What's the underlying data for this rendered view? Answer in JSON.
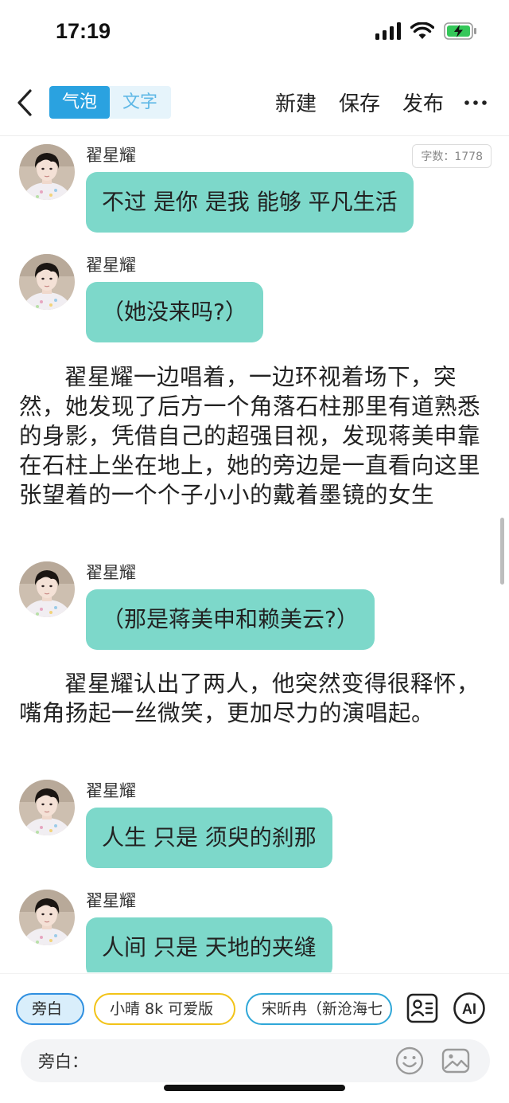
{
  "status": {
    "time": "17:19",
    "battery_color": "#34c759"
  },
  "nav": {
    "tabs": [
      {
        "label": "气泡",
        "active": true
      },
      {
        "label": "文字",
        "active": false
      }
    ],
    "new_label": "新建",
    "save_label": "保存",
    "publish_label": "发布",
    "accent": "#2aa2e0"
  },
  "word_count": "字数：1778",
  "messages": [
    {
      "type": "bubble",
      "speaker": "翟星耀",
      "text": "不过 是你 是我 能够 平凡生活"
    },
    {
      "type": "bubble",
      "speaker": "翟星耀",
      "text": "（她没来吗?）"
    },
    {
      "type": "narration",
      "text": "翟星耀一边唱着，一边环视着场下，突然，她发现了后方一个角落石柱那里有道熟悉的身影，凭借自己的超强目视，发现蒋美申靠在石柱上坐在地上，她的旁边是一直看向这里张望着的一个个子小小的戴着墨镜的女生"
    },
    {
      "type": "bubble",
      "speaker": "翟星耀",
      "text": "（那是蒋美申和赖美云?）"
    },
    {
      "type": "narration",
      "text": "翟星耀认出了两人，他突然变得很释怀，嘴角扬起一丝微笑，更加尽力的演唱起。"
    },
    {
      "type": "bubble",
      "speaker": "翟星耀",
      "text": "人生 只是 须臾的刹那"
    },
    {
      "type": "bubble",
      "speaker": "翟星耀",
      "text": "人间 只是 天地的夹缝"
    }
  ],
  "bubble_color": "#7dd8ca",
  "roles": [
    {
      "label": "旁白",
      "style": "active"
    },
    {
      "label": "小晴 8k 可爱版",
      "style": "yellow"
    },
    {
      "label": "宋昕冉（新沧海七",
      "style": "teal"
    }
  ],
  "input": {
    "label": "旁白：",
    "placeholder": ""
  },
  "icons": [
    "back-icon",
    "more-icon",
    "role-card-icon",
    "ai-icon",
    "emoji-icon",
    "image-icon",
    "avatar"
  ],
  "ai_label": "AI"
}
